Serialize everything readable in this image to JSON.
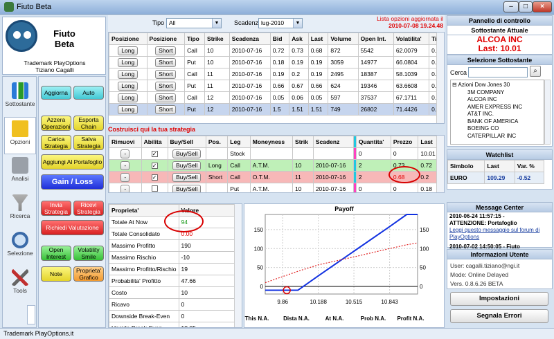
{
  "window": {
    "title": "Fiuto Beta"
  },
  "logo": {
    "brand_line1": "Fiuto",
    "brand_line2": "Beta",
    "trademark": "Trademark PlayOptions",
    "author": "Tiziano Cagalli"
  },
  "nav": [
    {
      "label": "Sottostante"
    },
    {
      "label": "Opzioni"
    },
    {
      "label": "Analisi"
    },
    {
      "label": "Ricerca"
    },
    {
      "label": "Selezione"
    },
    {
      "label": "Tools"
    }
  ],
  "buttons": {
    "aggiorna": "Aggiorna",
    "auto": "Auto",
    "azzera": "Azzera Operazioni",
    "esporta": "Esporta Chain",
    "carica": "Carica Strategia",
    "salva": "Salva Strategia",
    "aggiungi": "Aggiungi Al Portafoglio",
    "gainloss": "Gain / Loss",
    "invia": "Invia Strategia",
    "ricevi": "Ricevi Strategia",
    "richiedi": "Richiedi Valutazione",
    "open_interest": "Open Interest",
    "volatility": "Volatility Smile",
    "note": "Note",
    "proprieta": "Proprieta' Grafico"
  },
  "filters": {
    "tipo_label": "Tipo",
    "tipo_value": "All",
    "scadenza_label": "Scadenza",
    "scadenza_value": "lug-2010",
    "update_line1": "Lista opzioni aggiornata il",
    "update_line2": "2010-07-08 19.24.48"
  },
  "options_table": {
    "headers": [
      "Posizione",
      "Posizione",
      "Tipo",
      "Strike",
      "Scadenza",
      "Bid",
      "Ask",
      "Last",
      "Volume",
      "Open Int.",
      "Volatilita'",
      "Ti"
    ],
    "rows": [
      [
        "Long",
        "Short",
        "Call",
        "10",
        "2010-07-16",
        "0.72",
        "0.73",
        "0.68",
        "872",
        "5542",
        "62.0079",
        "0."
      ],
      [
        "Long",
        "Short",
        "Put",
        "10",
        "2010-07-16",
        "0.18",
        "0.19",
        "0.19",
        "3059",
        "14977",
        "66.0804",
        "0."
      ],
      [
        "Long",
        "Short",
        "Call",
        "11",
        "2010-07-16",
        "0.19",
        "0.2",
        "0.19",
        "2495",
        "18387",
        "58.1039",
        "0."
      ],
      [
        "Long",
        "Short",
        "Put",
        "11",
        "2010-07-16",
        "0.66",
        "0.67",
        "0.66",
        "624",
        "19346",
        "63.6608",
        "0."
      ],
      [
        "Long",
        "Short",
        "Call",
        "12",
        "2010-07-16",
        "0.05",
        "0.06",
        "0.05",
        "597",
        "37537",
        "67.1711",
        "0."
      ],
      [
        "Long",
        "Short",
        "Put",
        "12",
        "2010-07-16",
        "1.5",
        "1.51",
        "1.51",
        "749",
        "26802",
        "71.4426",
        "0."
      ]
    ]
  },
  "strategy": {
    "title": "Costruisci qui la tua strategia",
    "headers": [
      "Rimuovi",
      "Abilita",
      "Buy/Sell",
      "Pos.",
      "Leg",
      "Moneyness",
      "Strik",
      "Scadenz",
      "",
      "Quantita'",
      "Prezzo",
      "Last"
    ],
    "rows": [
      {
        "remove": "-",
        "check": "✓",
        "btn": "Buy/Sell",
        "pos": "",
        "leg": "Stock",
        "money": "",
        "strike": "",
        "scad": "",
        "qty": "0",
        "price": "0",
        "last": "10.01"
      },
      {
        "remove": "-",
        "check": "✓",
        "btn": "Buy/Sell",
        "pos": "Long",
        "leg": "Call",
        "money": "A.T.M.",
        "strike": "10",
        "scad": "2010-07-16",
        "qty": "2",
        "price": "0.73",
        "last": "0.72"
      },
      {
        "remove": "-",
        "check": "✓",
        "btn": "Buy/Sell",
        "pos": "Short",
        "leg": "Call",
        "money": "O.T.M.",
        "strike": "11",
        "scad": "2010-07-16",
        "qty": "2",
        "price": "0.68",
        "last": "0.2"
      },
      {
        "remove": "-",
        "check": "",
        "btn": "Buy/Sell",
        "pos": "",
        "leg": "Put",
        "money": "A.T.M.",
        "strike": "10",
        "scad": "2010-07-16",
        "qty": "0",
        "price": "0",
        "last": "0.18"
      }
    ]
  },
  "properties": {
    "headers": [
      "Proprieta'",
      "Valore"
    ],
    "rows": [
      [
        "Totale At Now",
        "94"
      ],
      [
        "Totale Consolidato",
        "0.00"
      ],
      [
        "Massimo Profitto",
        "190"
      ],
      [
        "Massimo Rischio",
        "-10"
      ],
      [
        "Massimo Profitto/Rischio",
        "19"
      ],
      [
        "Probabilita' Profitto",
        "47.66"
      ],
      [
        "Costo",
        "10"
      ],
      [
        "Ricavo",
        "0"
      ],
      [
        "Downside Break-Even",
        "0"
      ],
      [
        "Upside Break-Even",
        "10.05"
      ]
    ]
  },
  "payoff": {
    "title": "Payoff",
    "left_ticks": [
      "150",
      "100",
      "50",
      "0"
    ],
    "right_ticks": [
      "150",
      "100",
      "50",
      "0"
    ],
    "x_ticks": [
      "9.86",
      "10.188",
      "10.515",
      "10.843"
    ],
    "bottom_labels": [
      "This N.A.",
      "Dista N.A.",
      "At N.A.",
      "Prob N.A.",
      "Profit N.A."
    ]
  },
  "chart_data": {
    "type": "line",
    "title": "Payoff",
    "x": [
      9.7,
      9.86,
      10.0,
      10.188,
      10.515,
      10.843,
      11.0,
      11.1
    ],
    "series": [
      {
        "values": [
          -10,
          -10,
          -10,
          28,
          93,
          158,
          190,
          190
        ]
      },
      {
        "values": [
          10,
          26,
          40,
          57,
          78,
          100,
          110,
          115
        ]
      }
    ],
    "xlim": [
      9.7,
      11.1
    ],
    "ylim": [
      -20,
      190
    ]
  },
  "right": {
    "panel_title": "Pannello di controllo",
    "sottostante_title": "Sottostante Attuale",
    "ticker": "ALCOA INC",
    "last": "Last: 10.01",
    "selezione_title": "Selezione Sottostante",
    "cerca_label": "Cerca",
    "tree_root": "Azioni Dow Jones 30",
    "tree_items": [
      "3M COMPANY",
      "ALCOA INC",
      "AMER EXPRESS INC",
      "AT&T INC.",
      "BANK OF AMERICA",
      "BOEING CO",
      "CATERPILLAR INC"
    ],
    "watchlist_title": "Watchlist",
    "watch_headers": [
      "Simbolo",
      "Last",
      "Var. %"
    ],
    "watch_row": [
      "EURO",
      "109.29",
      "-0.52"
    ],
    "message_title": "Message Center",
    "msg1_date": "2010-06-24 11:57:15 -",
    "msg1_head": "ATTENZIONE: Portafoglio",
    "msg1_link": "Leggi questo messaggio sul forum di PlayOptions",
    "msg2_date": "2010-07-02 14:50:05 - Fiuto",
    "info_title": "Informazioni Utente",
    "user": "User: cagalli.tiziano@ngi.it",
    "mode": "Mode: Online Delayed",
    "version": "Vers. 0.8.6.26 BETA",
    "impostazioni": "Impostazioni",
    "segnala": "Segnala Errori"
  },
  "status": "Trademark PlayOptions.it"
}
